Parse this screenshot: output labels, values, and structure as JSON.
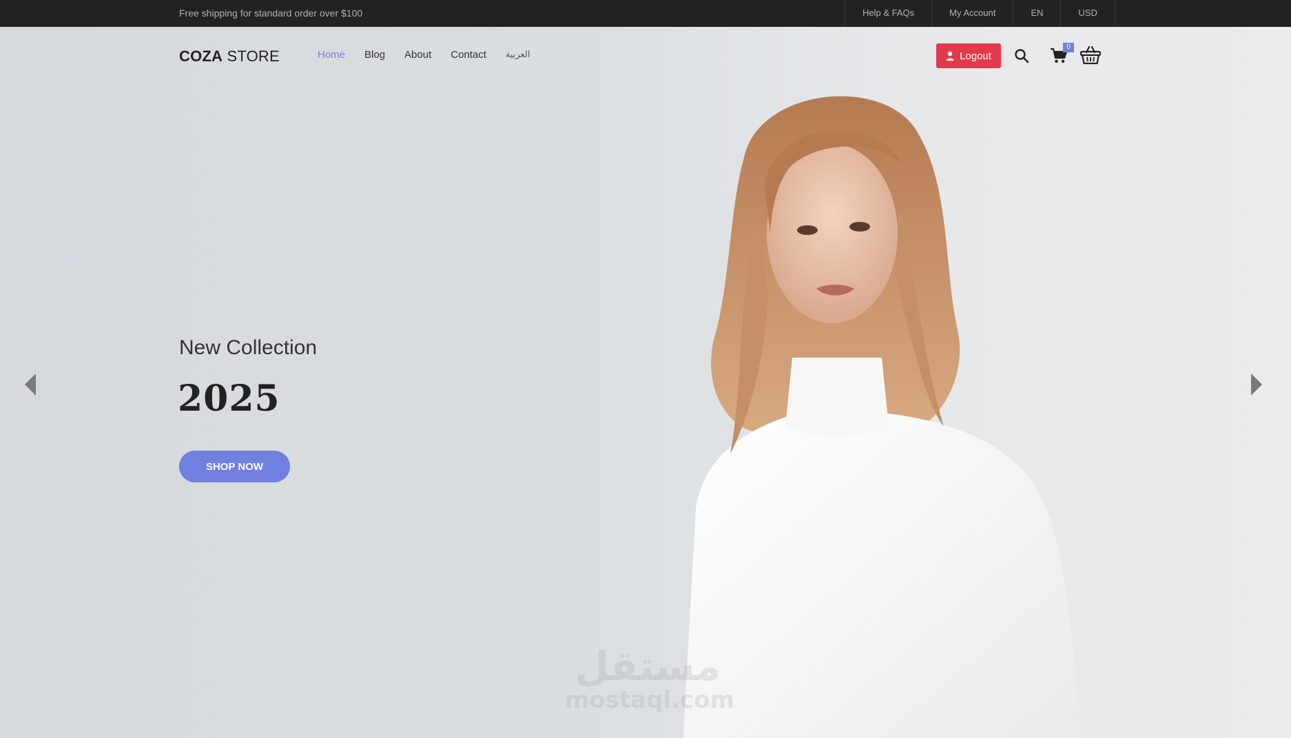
{
  "topbar": {
    "promo": "Free shipping for standard order over $100",
    "links": [
      "Help & FAQs",
      "My Account",
      "EN",
      "USD"
    ]
  },
  "header": {
    "logo_bold": "COZA",
    "logo_rest": " STORE",
    "nav": [
      "Home",
      "Blog",
      "About",
      "Contact",
      "العربية"
    ],
    "logout_label": "Logout",
    "cart_count": "0",
    "icons": [
      "user-icon",
      "search-icon",
      "cart-icon",
      "basket-icon"
    ]
  },
  "slide": {
    "subtitle": "New Collection",
    "title": "2025",
    "button": "SHOP NOW"
  },
  "watermark": {
    "arabic": "مستقل",
    "latin": "mostaql.com"
  },
  "colors": {
    "accent": "#717fe0",
    "logout": "#e23a4b",
    "topbar": "#222222"
  }
}
